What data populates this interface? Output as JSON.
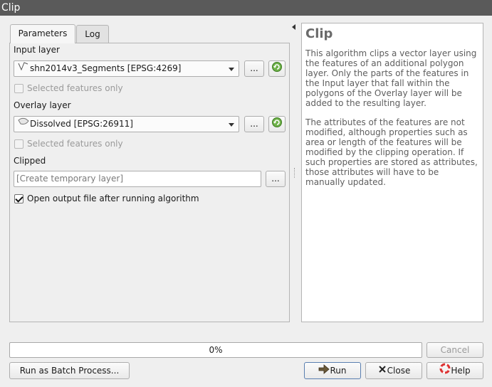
{
  "window": {
    "title": "Clip"
  },
  "tabs": [
    {
      "label": "Parameters"
    },
    {
      "label": "Log"
    }
  ],
  "params": {
    "input_layer_label": "Input layer",
    "input_layer_value": "shn2014v3_Segments [EPSG:4269]",
    "selected_only_label": "Selected features only",
    "overlay_layer_label": "Overlay layer",
    "overlay_layer_value": "Dissolved [EPSG:26911]",
    "overlay_selected_only_label": "Selected features only",
    "clipped_label": "Clipped",
    "clipped_placeholder": "[Create temporary layer]",
    "open_output_label": "Open output file after running algorithm",
    "browse_label": "..."
  },
  "help": {
    "title": "Clip",
    "para1": "This algorithm clips a vector layer using the features of an additional polygon layer. Only the parts of the features in the Input layer that fall within the polygons of the Overlay layer will be added to the resulting layer.",
    "para2": "The attributes of the features are not modified, although properties such as area or length of the features will be modified by the clipping operation. If such properties are stored as attributes, those attributes will have to be manually updated."
  },
  "progress": {
    "text": "0%",
    "value": 0
  },
  "buttons": {
    "cancel": "Cancel",
    "batch": "Run as Batch Process...",
    "run": "Run",
    "close": "Close",
    "help": "Help"
  },
  "icons": {
    "line_layer": "line-layer-icon",
    "polygon_layer": "polygon-layer-icon",
    "refresh": "iterate-icon",
    "run": "run-icon",
    "close": "close-icon",
    "help": "help-icon"
  }
}
